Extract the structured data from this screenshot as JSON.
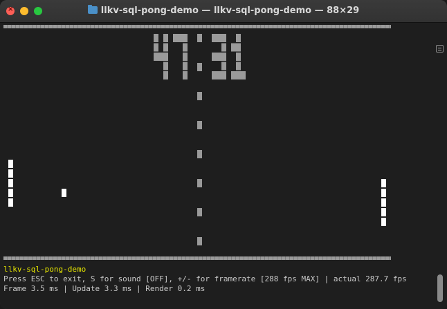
{
  "window": {
    "title": "llkv-sql-pong-demo — llkv-sql-pong-demo — 88×29",
    "close_icon": "close-icon",
    "folder_icon": "folder-icon"
  },
  "game": {
    "left_score": "47",
    "right_score": "31",
    "ball": "ball",
    "paddles": [
      "left-paddle",
      "right-paddle"
    ]
  },
  "status": {
    "app_name": "llkv-sql-pong-demo",
    "help": "Press ESC to exit, S for sound [OFF], +/- for framerate [288 fps MAX] | actual 287.7 fps",
    "timing": "Frame 3.5 ms | Update 3.3 ms | Render 0.2 ms"
  },
  "colors": {
    "title_yellow": "#e6e600",
    "text": "#c8c8c8",
    "paddle": "#ffffff",
    "net": "#9a9a9a"
  }
}
